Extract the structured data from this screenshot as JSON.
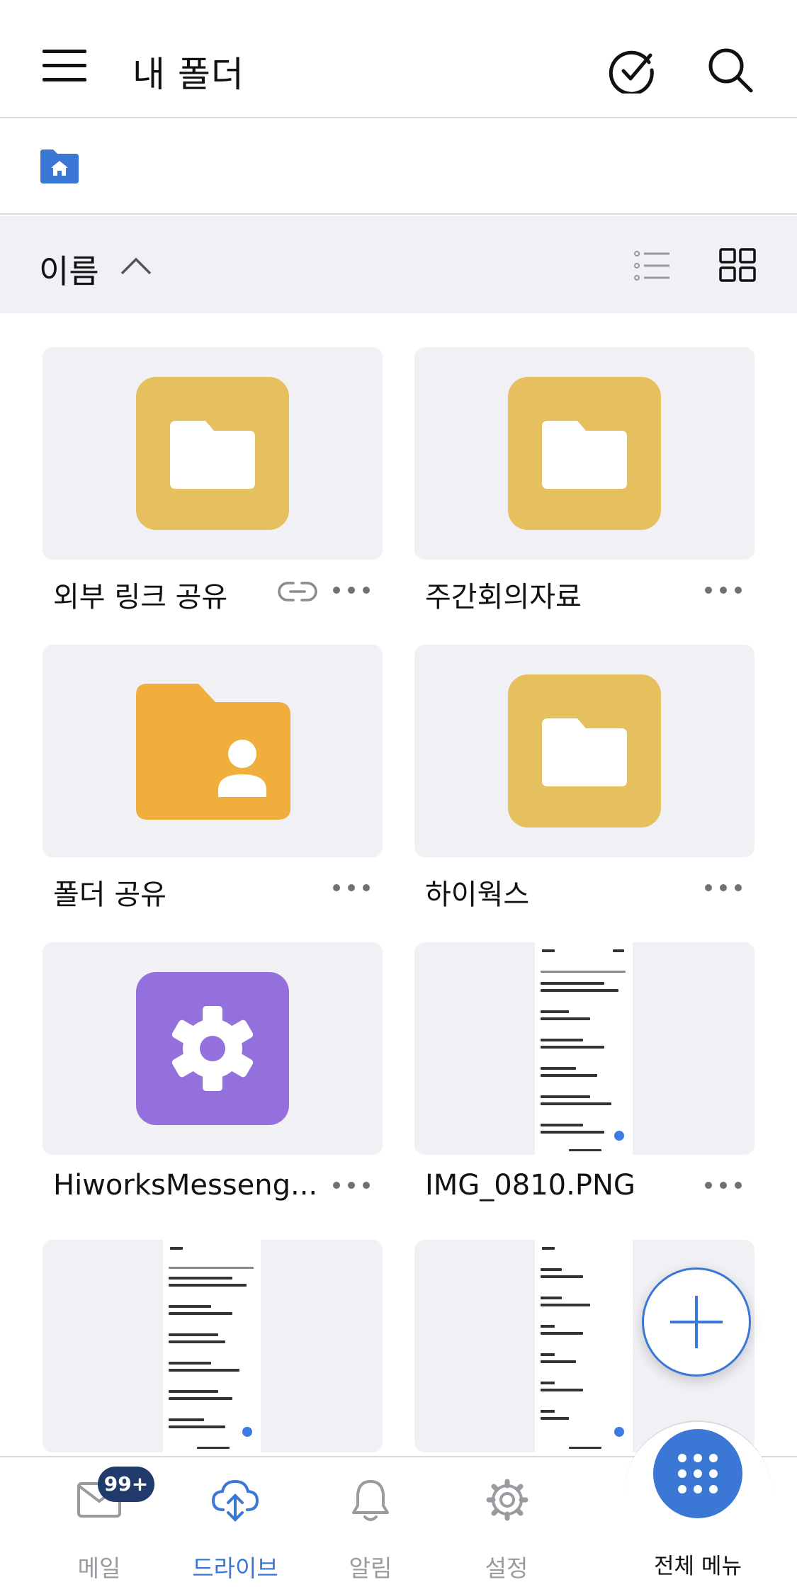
{
  "header": {
    "title": "내 폴더"
  },
  "sort": {
    "label": "이름"
  },
  "items": [
    {
      "name": "외부 링크 공유",
      "kind": "folder",
      "shared_link": true
    },
    {
      "name": "주간회의자료",
      "kind": "folder"
    },
    {
      "name": "폴더 공유",
      "kind": "shared-folder"
    },
    {
      "name": "하이웍스",
      "kind": "folder"
    },
    {
      "name": "HiworksMesseng...",
      "kind": "settings-folder"
    },
    {
      "name": "IMG_0810.PNG",
      "kind": "image"
    },
    {
      "name": "",
      "kind": "image"
    },
    {
      "name": "",
      "kind": "image"
    }
  ],
  "bottom_nav": {
    "mail": "메일",
    "mail_badge": "99+",
    "drive": "드라이브",
    "alerts": "알림",
    "settings": "설정",
    "all_menu": "전체 메뉴"
  },
  "colors": {
    "accent": "#3b78d6",
    "folder": "#e6bf5f",
    "shared_folder": "#f0ae3d",
    "settings_folder": "#9370db"
  }
}
